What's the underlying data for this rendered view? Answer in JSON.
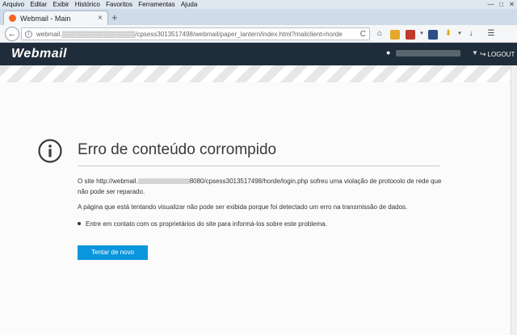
{
  "menubar": {
    "items": [
      "Arquivo",
      "Editar",
      "Exibir",
      "Histórico",
      "Favoritos",
      "Ferramentas",
      "Ajuda"
    ]
  },
  "window_controls": [
    "—",
    "□",
    "✕"
  ],
  "tab": {
    "title": "Webmail - Main",
    "close": "×",
    "new_tab": "+"
  },
  "navbar": {
    "back": "←",
    "url": "webmail.▒▒▒▒▒▒▒▒▒▒▒▒▒▒▒▒/cpsess3013517498/webmail/paper_lantern/index.html?mailclient=horde",
    "reload": "C",
    "icons": [
      "home-icon",
      "bookmarks-icon",
      "s-extension-icon",
      "n-extension-icon",
      "download-icon",
      "menu-icon"
    ]
  },
  "webmail": {
    "logo": "Webmail",
    "logout": "LOGOUT"
  },
  "error": {
    "title": "Erro de conteúdo corrompido",
    "p1_before": "O site http://webmail.",
    "p1_after": "8080/cpsess3013517498/horde/login.php sofreu uma violação de protocolo de rede que não pode ser reparado.",
    "p2": "A página que está tentando visualizar não pode ser exibida porque foi detectado um erro na transmissão de dados.",
    "bullet": "Entre em contato com os proprietários do site para informá-los sobre este problema.",
    "button": "Tentar de novo"
  },
  "colors": {
    "header_bg": "#1f2c3a",
    "button_bg": "#0a96dc",
    "tab_favicon": "#f26522"
  }
}
